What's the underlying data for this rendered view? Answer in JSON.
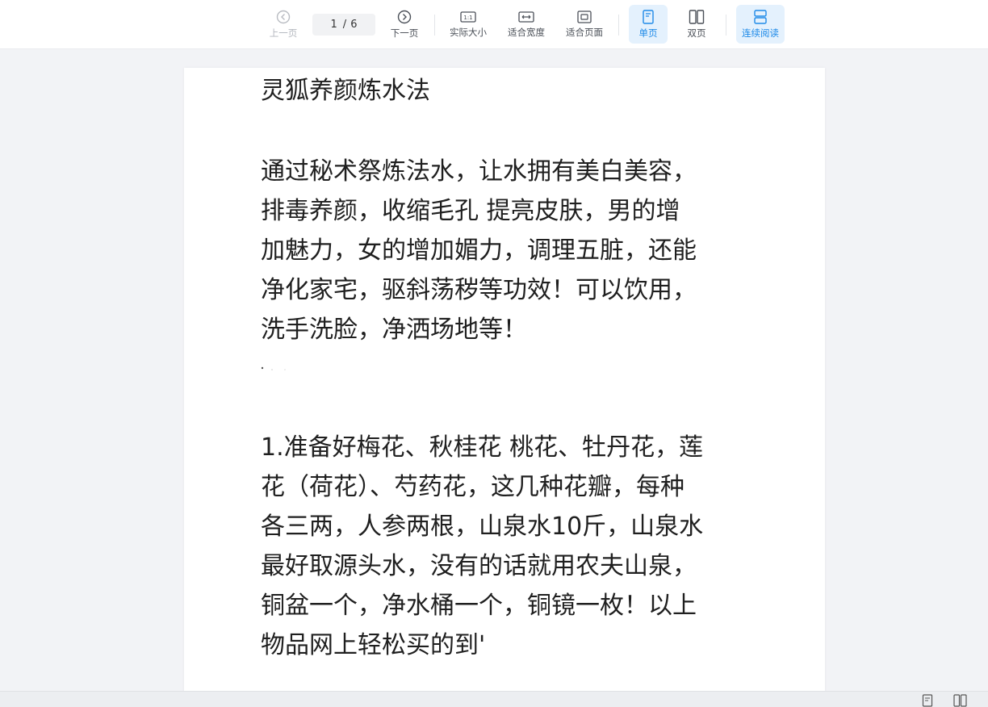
{
  "toolbar": {
    "prev_label": "上一页",
    "page_current": "1",
    "page_separator": "/",
    "page_total": "6",
    "next_label": "下一页",
    "actual_size_label": "实际大小",
    "fit_width_label": "适合宽度",
    "fit_page_label": "适合页面",
    "single_page_label": "单页",
    "double_page_label": "双页",
    "continuous_label": "连续阅读",
    "actual_size_icon_text": "1:1"
  },
  "document": {
    "title": "灵狐养颜炼水法",
    "paragraph1_lines": [
      "通过秘术祭炼法水，让水拥有美白美容，",
      "排毒养颜，收缩毛孔   提亮皮肤，男的增",
      "加魅力，女的增加媚力，调理五脏，还能",
      "净化家宅，驱斜荡秽等功效！可以饮用，",
      "洗手洗脸，净洒场地等！"
    ],
    "paragraph2_lines": [
      "1.准备好梅花、秋桂花   桃花、牡丹花，莲",
      "花（荷花）、芍药花，这几种花瓣，每种",
      "各三两，人参两根，山泉水10斤，山泉水",
      "最好取源头水，没有的话就用农夫山泉，",
      "铜盆一个，净水桶一个，铜镜一枚！以上",
      "物品网上轻松买的到'"
    ]
  },
  "colors": {
    "accent": "#1e8ae8",
    "active_bg": "#e4f1fd",
    "page_bg": "#f2f3f6"
  }
}
